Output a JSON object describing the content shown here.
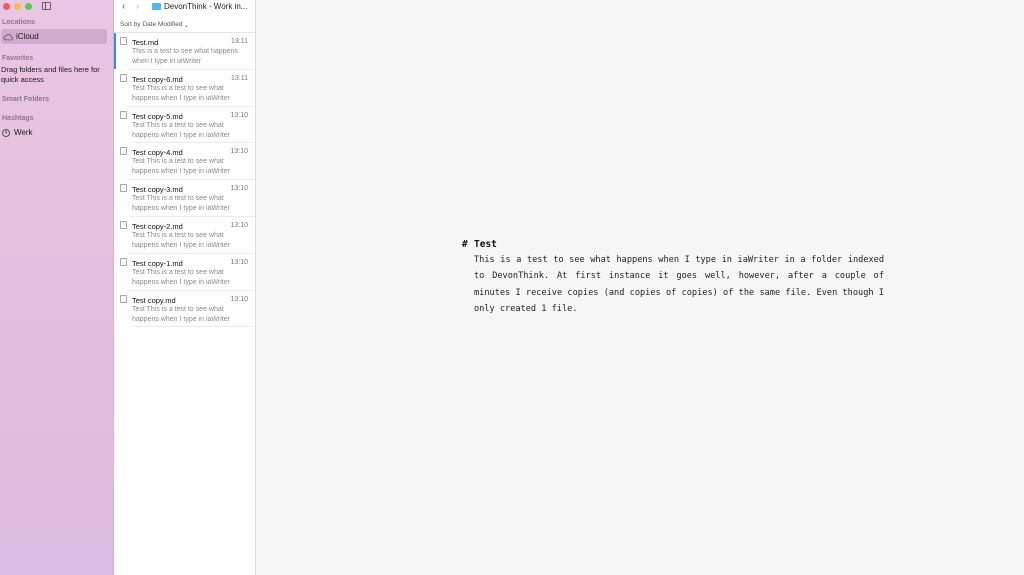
{
  "sidebar": {
    "locations_label": "Locations",
    "icloud_label": "iCloud",
    "favorites_label": "Favorites",
    "favorites_hint": "Drag folders and files here for quick access",
    "smart_folders_label": "Smart Folders",
    "hashtags_label": "Hashtags",
    "tag_label": "Werk"
  },
  "toolbar": {
    "folder_title": "DevonThink - Work in...",
    "back_icon": "chevron-left-icon",
    "forward_icon": "chevron-right-icon"
  },
  "list": {
    "sort_label": "Sort by Date Modified",
    "files": [
      {
        "name": "Test.md",
        "time": "13:11",
        "preview": "This is a test to see what happens when I type in iaWriter",
        "selected": true
      },
      {
        "name": "Test copy-6.md",
        "time": "13:11",
        "preview": "Test This is a test to see what happens when I type in iaWriter",
        "selected": false
      },
      {
        "name": "Test copy-5.md",
        "time": "13:10",
        "preview": "Test This is a test to see what happens when I type in iaWriter",
        "selected": false
      },
      {
        "name": "Test copy-4.md",
        "time": "13:10",
        "preview": "Test This is a test to see what happens when I type in iaWriter",
        "selected": false
      },
      {
        "name": "Test copy-3.md",
        "time": "13:10",
        "preview": "Test This is a test to see what happens when I type in iaWriter",
        "selected": false
      },
      {
        "name": "Test copy-2.md",
        "time": "13:10",
        "preview": "Test This is a test to see what happens when I type in iaWriter",
        "selected": false
      },
      {
        "name": "Test copy-1.md",
        "time": "13:10",
        "preview": "Test This is a test to see what happens when I type in iaWriter",
        "selected": false
      },
      {
        "name": "Test copy.md",
        "time": "13:10",
        "preview": "Test This is a test to see what happens when I type in iaWriter",
        "selected": false
      }
    ]
  },
  "editor": {
    "heading_mark": "#",
    "heading": "Test",
    "body": "This is a test to see what happens when I  type in iaWriter in a folder indexed to DevonThink. At first instance it goes well, however, after a couple of minutes I receive copies (and copies of copies) of the same file. Even though I only created 1 file."
  },
  "colors": {
    "selection_accent": "#2f8fe3",
    "sidebar_bg": "#e6c1dd",
    "folder_icon": "#5fb3e8"
  }
}
